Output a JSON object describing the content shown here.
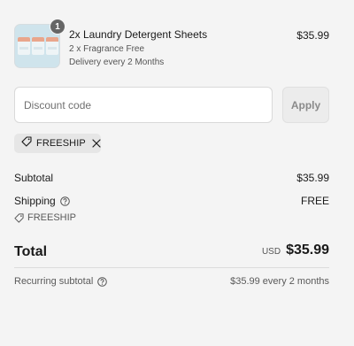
{
  "product": {
    "name": "2x Laundry Detergent Sheets",
    "variant": "2 x Fragrance Free",
    "delivery": "Delivery every 2 Months",
    "price": "$35.99",
    "quantity": "1",
    "image_icon": "detergent-sheets-thumbnail"
  },
  "discount": {
    "placeholder": "Discount code",
    "value": "",
    "apply_label": "Apply"
  },
  "applied_code": {
    "label": "FREESHIP",
    "tag_icon": "tag-icon",
    "remove_icon": "close-icon"
  },
  "summary": {
    "subtotal_label": "Subtotal",
    "subtotal_value": "$35.99",
    "shipping_label": "Shipping",
    "shipping_value": "FREE",
    "shipping_discount": "FREESHIP",
    "total_label": "Total",
    "currency": "USD",
    "total_value": "$35.99",
    "recurring_label": "Recurring subtotal",
    "recurring_value": "$35.99 every 2 months"
  },
  "colors": {
    "background": "#f4f4f4",
    "text": "#1a1a1a",
    "muted": "#5a5a5a",
    "badge": "#666666",
    "chip": "#e6e6e6"
  }
}
